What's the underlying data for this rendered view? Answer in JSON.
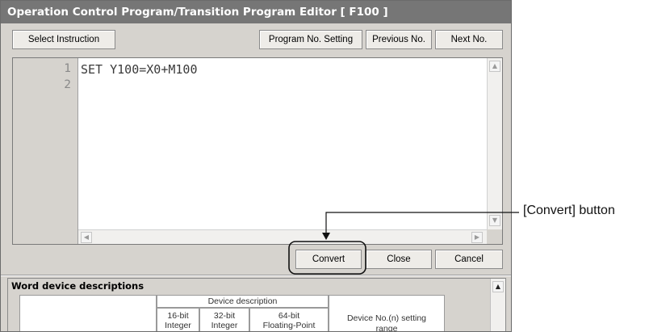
{
  "window": {
    "title": "Operation Control Program/Transition Program Editor [ F100 ]"
  },
  "toolbar": {
    "select_instruction_label": "Select Instruction",
    "program_no_setting_label": "Program No. Setting",
    "previous_no_label": "Previous No.",
    "next_no_label": "Next No."
  },
  "editor": {
    "line_numbers": [
      "1",
      "2"
    ],
    "lines": [
      "SET Y100=X0+M100",
      ""
    ]
  },
  "actions": {
    "convert_label": "Convert",
    "close_label": "Close",
    "cancel_label": "Cancel"
  },
  "word_device": {
    "title": "Word device descriptions",
    "device_description_header": "Device description",
    "col_16bit": "16-bit\nInteger",
    "col_32bit": "32-bit\nInteger",
    "col_64bit": "64-bit\nFloating-Point",
    "setting_range_header": "Device No.(n) setting range"
  },
  "annotation": {
    "convert_callout": "[Convert] button"
  },
  "colors": {
    "title_bar": "#767676",
    "dialog_face": "#d6d3ce"
  }
}
